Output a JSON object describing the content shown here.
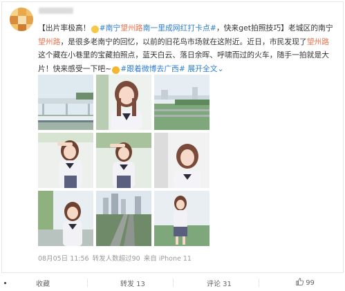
{
  "post": {
    "segments": [
      {
        "t": "【出片率极高！",
        "c": ""
      },
      {
        "t": "😮",
        "c": "emoji"
      },
      {
        "t": "#南宁",
        "c": "topic"
      },
      {
        "t": "望州路",
        "c": "link"
      },
      {
        "t": "南一里成网红打卡点#",
        "c": "topic"
      },
      {
        "t": "，快来get拍照技巧】老城区的南宁",
        "c": ""
      },
      {
        "t": "望州路",
        "c": "link"
      },
      {
        "t": "，是很多老南宁的回忆，以前的旧花鸟市场就在这附近。近日，市民发现了",
        "c": ""
      },
      {
        "t": "望州路",
        "c": "link"
      },
      {
        "t": "这个藏在小巷里的宝藏拍照点，蓝天白云、落日余晖、呼啸而过的火车，随手一拍就是大片！快来感受一下吧~",
        "c": ""
      },
      {
        "t": "🧭",
        "c": "emoji2"
      },
      {
        "t": "#跟着微博去广西#",
        "c": "topic"
      },
      {
        "t": " ",
        "c": ""
      },
      {
        "t": "展开全文",
        "c": "blue"
      },
      {
        "t": "⌄",
        "c": "blue"
      }
    ]
  },
  "meta": {
    "date": "08月05日 11:56",
    "reposts_info": "转发人数超过90",
    "source": "来自 iPhone 11"
  },
  "actions": {
    "favorite": "收藏",
    "repost": "转发 13",
    "comment": "评论 31",
    "like": "99"
  },
  "icons": [
    "thumb-up-icon"
  ],
  "colors": {
    "link": "#eb7350",
    "topic": "#2d7dd2"
  }
}
